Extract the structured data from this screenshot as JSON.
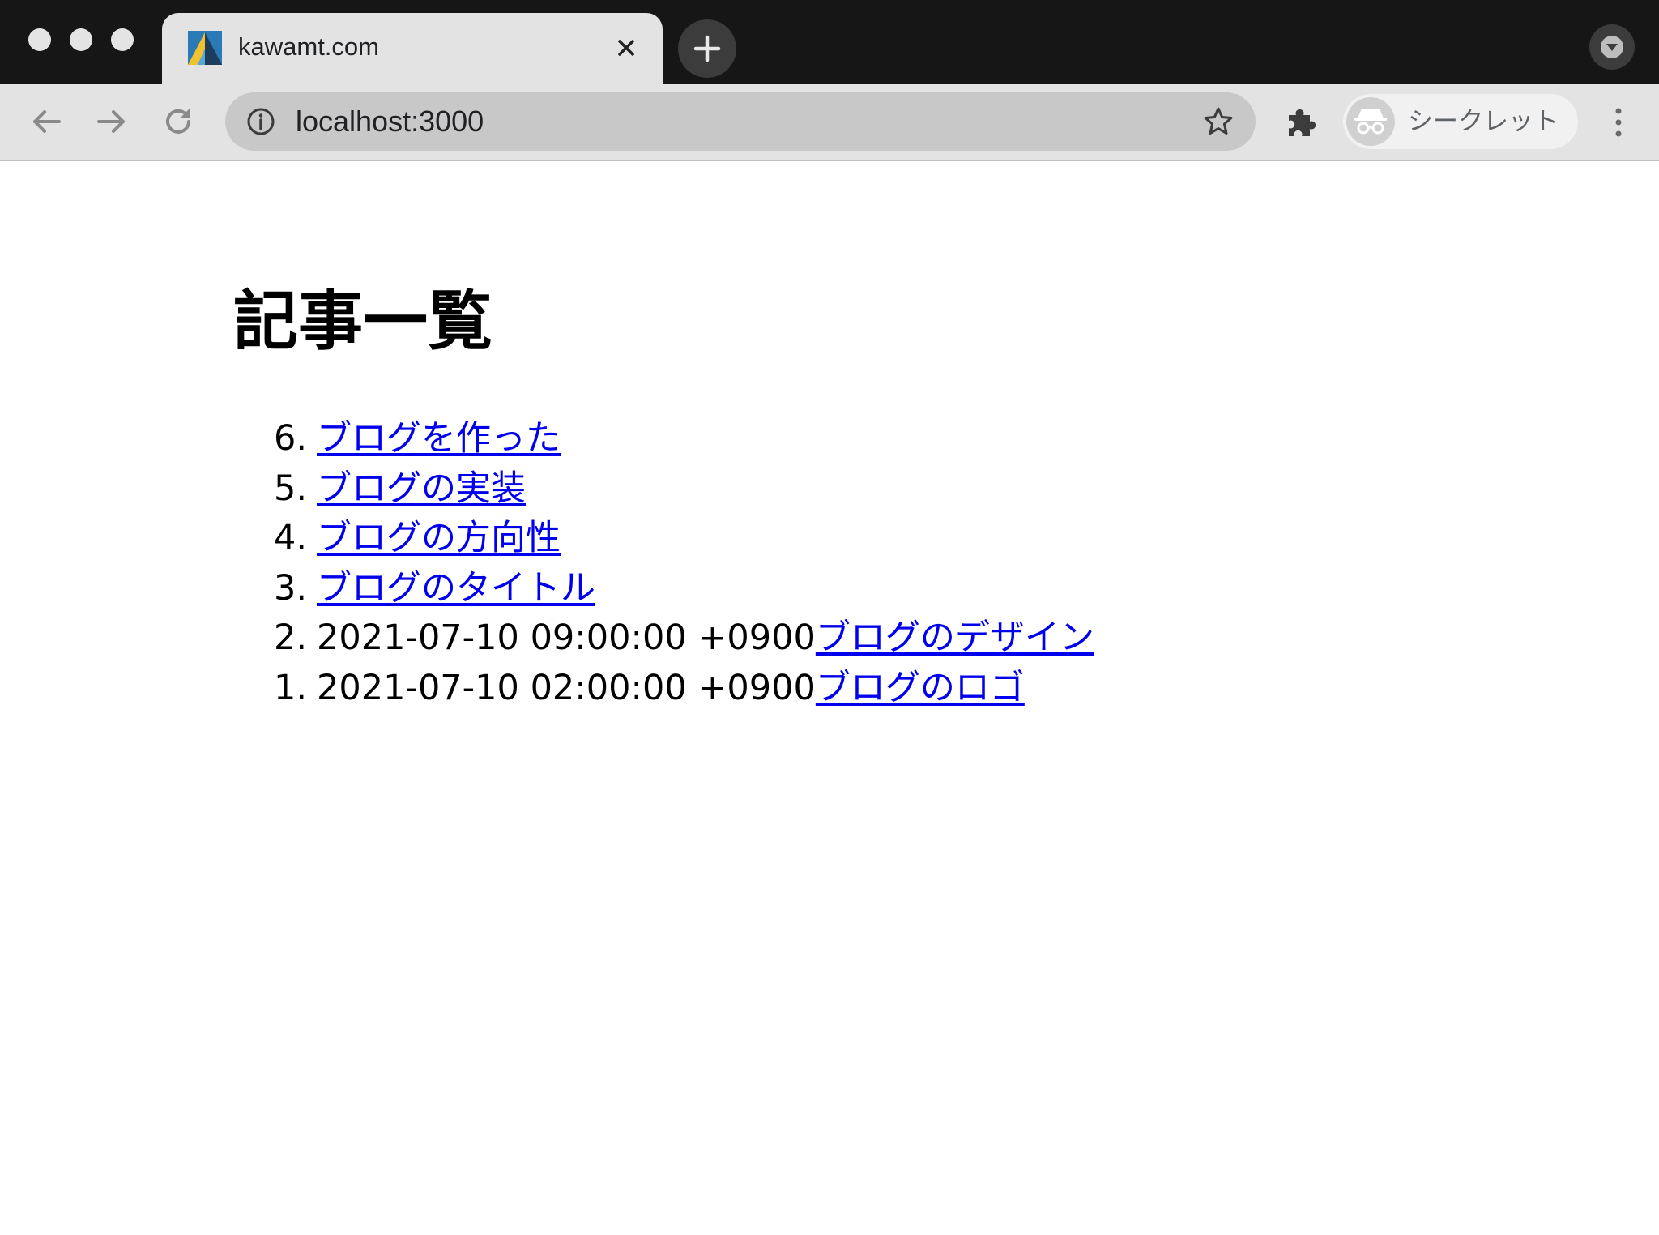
{
  "browser": {
    "tab": {
      "title": "kawamt.com"
    },
    "address_bar": {
      "url": "localhost:3000"
    },
    "incognito": {
      "label": "シークレット"
    }
  },
  "page": {
    "title": "記事一覧",
    "articles": [
      {
        "number": "6.",
        "date": "",
        "title": "ブログを作った"
      },
      {
        "number": "5.",
        "date": "",
        "title": "ブログの実装"
      },
      {
        "number": "4.",
        "date": "",
        "title": "ブログの方向性"
      },
      {
        "number": "3.",
        "date": "",
        "title": "ブログのタイトル"
      },
      {
        "number": "2.",
        "date": "2021-07-10 09:00:00 +0900",
        "title": "ブログのデザイン"
      },
      {
        "number": "1.",
        "date": "2021-07-10 02:00:00 +0900",
        "title": "ブログのロゴ"
      }
    ]
  },
  "colors": {
    "titlebar": "#161616",
    "toolbar": "#e3e3e3",
    "omnibox": "#c8c8c8",
    "link": "#0000ee"
  },
  "icons": {
    "favicon": "kawamt-logo-icon",
    "close": "close-icon",
    "new_tab": "plus-icon",
    "profile_menu": "chevron-down-icon",
    "back": "arrow-left-icon",
    "forward": "arrow-right-icon",
    "reload": "reload-icon",
    "info": "info-icon",
    "bookmark": "star-icon",
    "extensions": "puzzle-icon",
    "incognito": "incognito-icon",
    "menu": "kebab-menu-icon"
  }
}
